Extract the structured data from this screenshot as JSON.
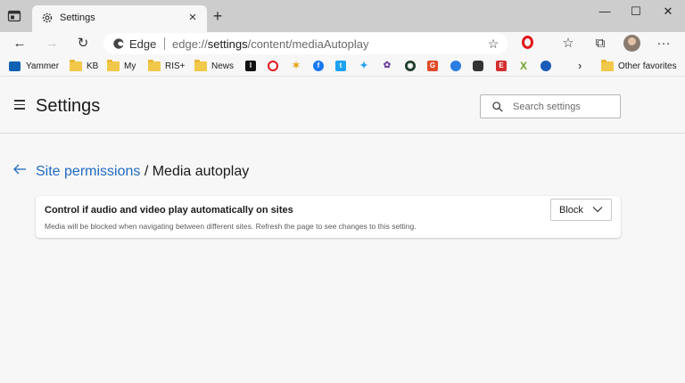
{
  "browser": {
    "tab": {
      "title": "Settings"
    },
    "address": {
      "brand": "Edge",
      "url_prefix": "edge://",
      "url_host": "settings",
      "url_path": "/content/mediaAutoplay"
    },
    "window_controls": {
      "minimize": "—",
      "maximize": "☐",
      "close": "✕"
    }
  },
  "favorites": {
    "items": [
      {
        "label": "Yammer",
        "icon": "yammer-icon"
      },
      {
        "label": "KB",
        "icon": "folder-icon"
      },
      {
        "label": "My",
        "icon": "folder-icon"
      },
      {
        "label": "RIS+",
        "icon": "folder-icon"
      },
      {
        "label": "News",
        "icon": "folder-icon"
      }
    ],
    "more_label": "Other favorites"
  },
  "settings": {
    "title": "Settings",
    "search_placeholder": "Search settings",
    "breadcrumb": {
      "parent": "Site permissions",
      "separator": " / ",
      "current": "Media autoplay"
    },
    "autoplay": {
      "title": "Control if audio and video play automatically on sites",
      "description": "Media will be blocked when navigating between different sites. Refresh the page to see changes to this setting.",
      "selected": "Block"
    }
  },
  "colors": {
    "link": "#1f6bc1",
    "tab_strip": "#cdcdcd",
    "page_bg": "#f7f7f7"
  }
}
